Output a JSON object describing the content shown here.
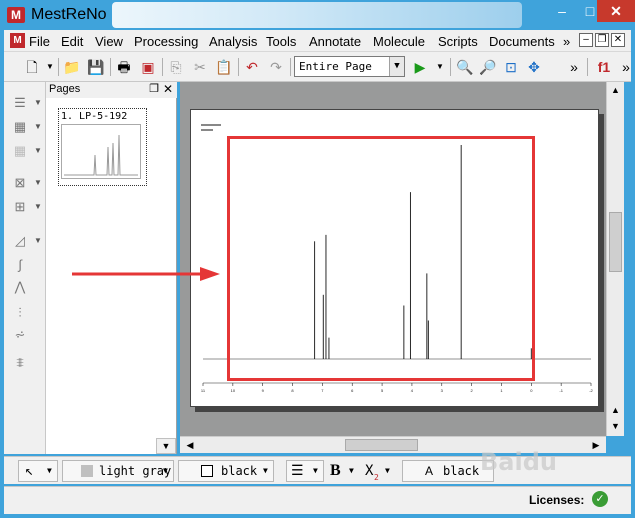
{
  "app": {
    "title": "MestReNo"
  },
  "menu": {
    "items": [
      "File",
      "Edit",
      "View",
      "Processing",
      "Analysis",
      "Tools",
      "Annotate",
      "Molecule",
      "Scripts",
      "Documents"
    ],
    "overflow": "»"
  },
  "toolbar": {
    "zoom_value": "Entire Page",
    "overflow": "»"
  },
  "pages_panel": {
    "title": "Pages",
    "page_label": "1. LP-5-192"
  },
  "style_bar": {
    "fill_color": "light gray",
    "line_color": "black",
    "bold": "B",
    "subscript": "X",
    "font_color_label": "A",
    "font_color": "black"
  },
  "status": {
    "licenses": "Licenses:"
  },
  "watermark": "Baidu",
  "colors": {
    "titlebar": "#3fa3db",
    "highlight": "#e53636",
    "close_button": "#c7392c"
  },
  "chart_data": {
    "type": "line",
    "title": "",
    "xlabel": "",
    "ylabel": "",
    "x_reversed": true,
    "xlim": [
      11,
      -2
    ],
    "x_ticks": [
      11,
      10,
      9,
      8,
      7,
      6,
      5,
      4,
      3,
      2,
      1,
      0,
      -1,
      -2
    ],
    "peaks": [
      {
        "x": 7.26,
        "y": 0.55
      },
      {
        "x": 6.97,
        "y": 0.3
      },
      {
        "x": 6.88,
        "y": 0.58
      },
      {
        "x": 6.78,
        "y": 0.1
      },
      {
        "x": 4.27,
        "y": 0.25
      },
      {
        "x": 4.05,
        "y": 0.78
      },
      {
        "x": 3.5,
        "y": 0.4
      },
      {
        "x": 3.45,
        "y": 0.18
      },
      {
        "x": 2.35,
        "y": 1.0
      },
      {
        "x": 0.0,
        "y": 0.05
      }
    ]
  }
}
